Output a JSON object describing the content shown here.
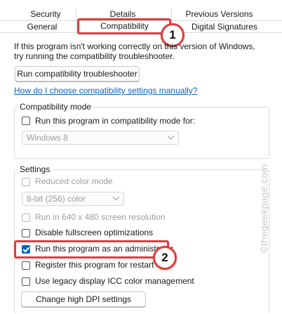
{
  "tabs": {
    "row1": [
      "Security",
      "Details",
      "Previous Versions"
    ],
    "row2": [
      "General",
      "Compatibility",
      "Digital Signatures"
    ],
    "active": "Compatibility"
  },
  "intro": {
    "line1": "If this program isn't working correctly on this version of Windows,",
    "line2": "try running the compatibility troubleshooter."
  },
  "troubleshooter_button": "Run compatibility troubleshooter",
  "help_link": "How do I choose compatibility settings manually?",
  "compat_mode": {
    "title": "Compatibility mode",
    "checkbox_label": "Run this program in compatibility mode for:",
    "checked": false,
    "select_value": "Windows 8"
  },
  "settings": {
    "title": "Settings",
    "reduced_color": {
      "label": "Reduced color mode",
      "checked": false,
      "disabled": true
    },
    "color_select_value": "8-bit (256) color",
    "res_640": {
      "label": "Run in 640 x 480 screen resolution",
      "checked": false,
      "disabled": true
    },
    "fullscreen_opt": {
      "label": "Disable fullscreen optimizations",
      "checked": false
    },
    "run_as_admin": {
      "label": "Run this program as an administrator",
      "checked": true
    },
    "register_restart": {
      "label": "Register this program for restart",
      "checked": false
    },
    "legacy_icc": {
      "label": "Use legacy display ICC color management",
      "checked": false
    },
    "dpi_button": "Change high DPI settings"
  },
  "annotations": {
    "step1": "1",
    "step2": "2",
    "color": "#e23b3b"
  },
  "watermark": "©thegeekpage.com"
}
